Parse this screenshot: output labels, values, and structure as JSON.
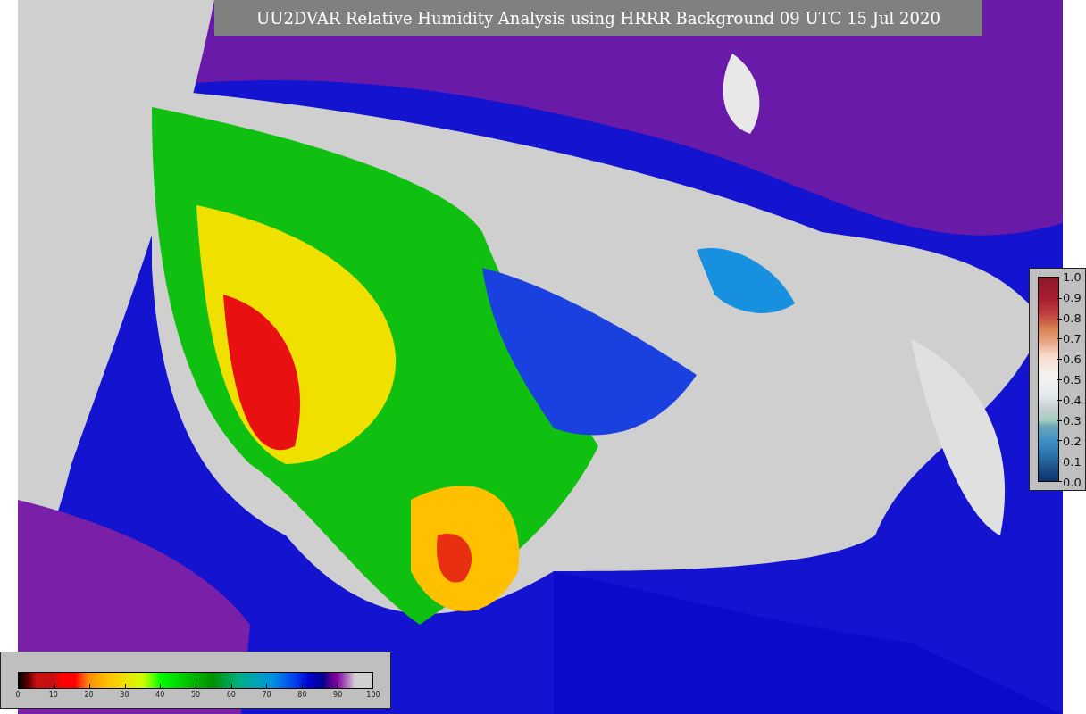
{
  "title": "UU2DVAR Relative Humidity Analysis using HRRR Background 09 UTC 15 Jul 2020",
  "humidity_colorbar": {
    "ticks": [
      "0",
      "10",
      "20",
      "30",
      "40",
      "50",
      "60",
      "70",
      "80",
      "90",
      "100"
    ]
  },
  "observation_colorbar": {
    "ticks": [
      "1.0",
      "0.9",
      "0.8",
      "0.7",
      "0.6",
      "0.5",
      "0.4",
      "0.3",
      "0.2",
      "0.1",
      "0.0"
    ]
  }
}
